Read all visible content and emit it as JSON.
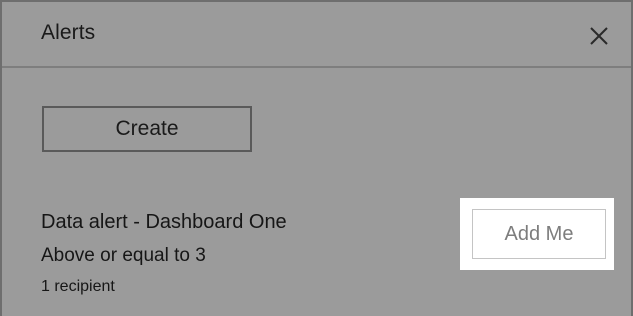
{
  "header": {
    "title": "Alerts",
    "close_icon": "close-icon"
  },
  "actions": {
    "create_label": "Create"
  },
  "alert": {
    "name": "Data alert - Dashboard One",
    "condition": "Above or equal to 3",
    "recipients": "1 recipient",
    "add_me_label": "Add Me"
  },
  "colors": {
    "panel_bg": "#9b9b9b",
    "highlight_bg": "#ffffff",
    "text": "#1a1a1a",
    "disabled_text": "#7d7d7d"
  }
}
